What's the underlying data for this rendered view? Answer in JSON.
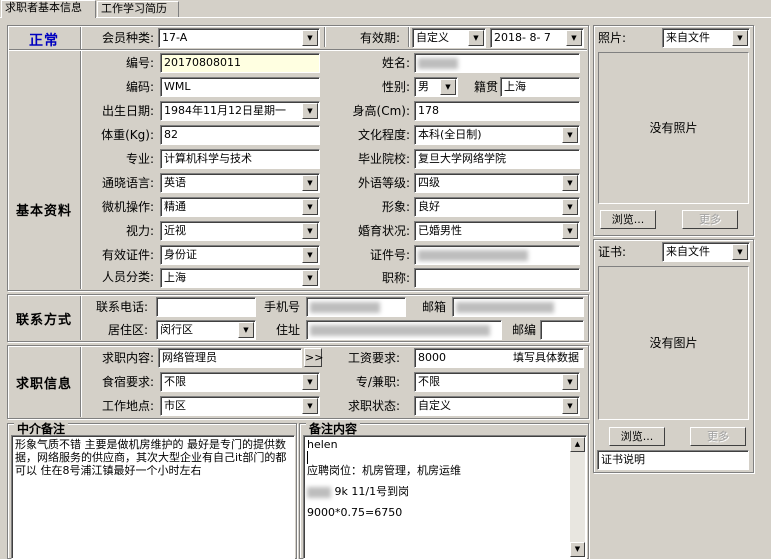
{
  "tabs": [
    "求职者基本信息",
    "工作学习简历"
  ],
  "status": "正常",
  "sections": {
    "basic": "基本资料",
    "contact": "联系方式",
    "job": "求职信息"
  },
  "member": {
    "label": "会员种类:",
    "value": "17-A"
  },
  "validity": {
    "label": "有效期:",
    "type": "自定义",
    "date": "2018- 8- 7"
  },
  "fields": {
    "id_label": "编号:",
    "id_value": "20170808011",
    "name_label": "姓名:",
    "code_label": "编码:",
    "code_value": "WML",
    "gender_label": "性别:",
    "gender_value": "男",
    "native_label": "籍贯",
    "native_value": "上海",
    "birth_label": "出生日期:",
    "birth_value": "1984年11月12日星期一",
    "height_label": "身高(Cm):",
    "height_value": "178",
    "weight_label": "体重(Kg):",
    "weight_value": "82",
    "edu_label": "文化程度:",
    "edu_value": "本科(全日制)",
    "major_label": "专业:",
    "major_value": "计算机科学与技术",
    "school_label": "毕业院校:",
    "school_value": "复旦大学网络学院",
    "lang_label": "通晓语言:",
    "lang_value": "英语",
    "langlevel_label": "外语等级:",
    "langlevel_value": "四级",
    "pc_label": "微机操作:",
    "pc_value": "精通",
    "look_label": "形象:",
    "look_value": "良好",
    "vision_label": "视力:",
    "vision_value": "近视",
    "marriage_label": "婚育状况:",
    "marriage_value": "已婚男性",
    "cert_label": "有效证件:",
    "cert_value": "身份证",
    "certno_label": "证件号:",
    "cat_label": "人员分类:",
    "cat_value": "上海",
    "title_label": "职称:"
  },
  "contact": {
    "phone_label": "联系电话:",
    "mobile_label": "手机号",
    "email_label": "邮箱",
    "district_label": "居住区:",
    "district_value": "闵行区",
    "address_label": "住址",
    "zip_label": "邮编"
  },
  "job": {
    "content_label": "求职内容:",
    "content_value": "网络管理员",
    "more_btn": ">>",
    "salary_label": "工资要求:",
    "salary_value": "8000",
    "salary_hint": "填写具体数据",
    "board_label": "食宿要求:",
    "board_value": "不限",
    "type_label": "专/兼职:",
    "type_value": "不限",
    "place_label": "工作地点:",
    "place_value": "市区",
    "state_label": "求职状态:",
    "state_value": "自定义"
  },
  "agent_note": {
    "title": "中介备注",
    "text": "形象气质不错  主要是做机房维护的  最好是专门的提供数据，网络服务的供应商，其次大型企业有自己it部门的都可以    住在8号浦江镇最好一个小时左右"
  },
  "note": {
    "title": "备注内容",
    "line1": "helen",
    "line2": "应聘岗位：机房管理，机房运维",
    "line3": "9k  11/1号到岗",
    "line4": "9000*0.75=6750"
  },
  "photo": {
    "label": "照片:",
    "source": "来自文件",
    "empty": "没有照片",
    "browse": "浏览...",
    "more": "更多"
  },
  "certificate": {
    "label": "证书:",
    "source": "来自文件",
    "empty": "没有图片",
    "browse": "浏览...",
    "more": "更多",
    "desc": "证书说明"
  }
}
